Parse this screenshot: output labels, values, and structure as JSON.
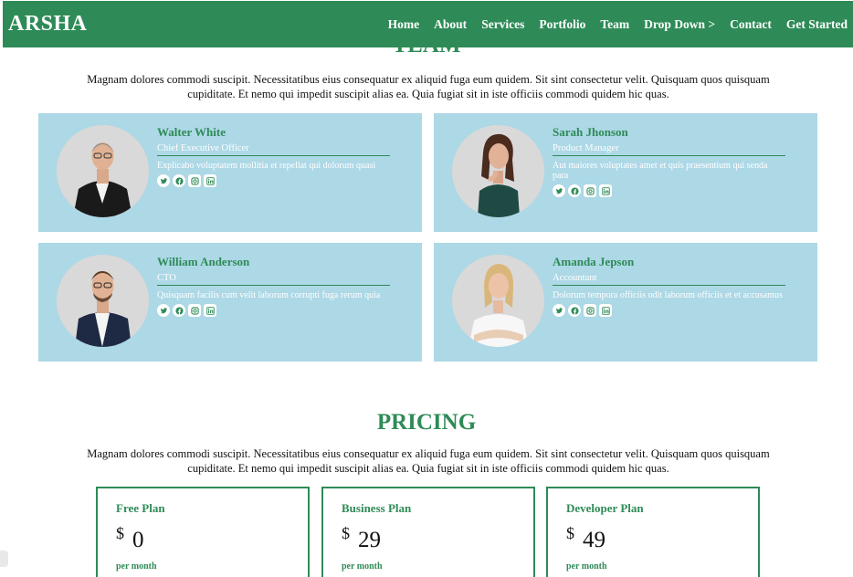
{
  "header": {
    "logo": "ARSHA",
    "nav": [
      "Home",
      "About",
      "Services",
      "Portfolio",
      "Team",
      "Drop Down >",
      "Contact",
      "Get Started"
    ]
  },
  "team": {
    "title": "TEAM",
    "description": "Magnam dolores commodi suscipit. Necessitatibus eius consequatur ex aliquid fuga eum quidem. Sit sint consectetur velit. Quisquam quos quisquam cupiditate. Et nemo qui impedit suscipit alias ea. Quia fugiat sit in iste officiis commodi quidem hic quas.",
    "members": [
      {
        "name": "Walter White",
        "role": "Chief Executive Officer",
        "desc": "Explicabo voluptatem mollitia et repellat qui dolorum quasi"
      },
      {
        "name": "Sarah Jhonson",
        "role": "Product Manager",
        "desc": "Aut maiores voluptates amet et quis praesentium qui senda para"
      },
      {
        "name": "William Anderson",
        "role": "CTO",
        "desc": "Quisquam facilis cum velit laborum corrupti fuga rerum quia"
      },
      {
        "name": "Amanda Jepson",
        "role": "Accountant",
        "desc": "Dolorum tempora officiis odit laborum officiis et et accusamus"
      }
    ],
    "social_icons": [
      "twitter-icon",
      "facebook-icon",
      "instagram-icon",
      "linkedin-icon"
    ]
  },
  "pricing": {
    "title": "PRICING",
    "description": "Magnam dolores commodi suscipit. Necessitatibus eius consequatur ex aliquid fuga eum quidem. Sit sint consectetur velit. Quisquam quos quisquam cupiditate. Et nemo qui impedit suscipit alias ea. Quia fugiat sit in iste officiis commodi quidem hic quas.",
    "plans": [
      {
        "name": "Free Plan",
        "currency": "$",
        "price": "0",
        "period": "per month"
      },
      {
        "name": "Business Plan",
        "currency": "$",
        "price": "29",
        "period": "per month"
      },
      {
        "name": "Developer Plan",
        "currency": "$",
        "price": "49",
        "period": "per month"
      }
    ]
  },
  "colors": {
    "primary": "#2e8b57",
    "card_bg": "#add8e6"
  }
}
